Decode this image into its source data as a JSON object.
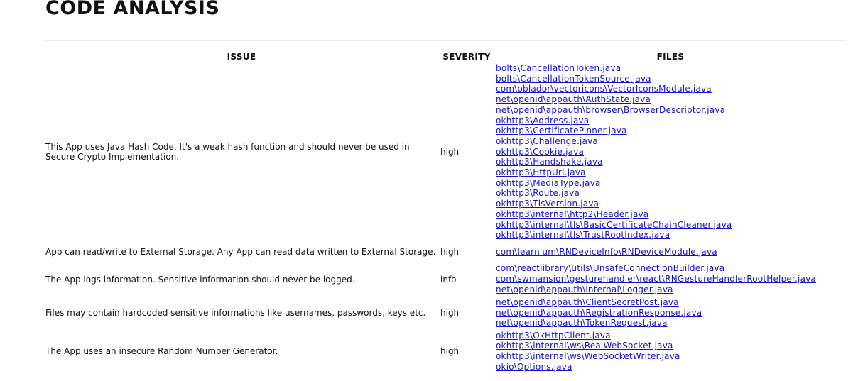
{
  "page": {
    "title": "CODE ANALYSIS"
  },
  "table": {
    "headers": {
      "issue": "ISSUE",
      "severity": "SEVERITY",
      "files": "FILES"
    },
    "rows": [
      {
        "issue": "This App uses Java Hash Code. It's a weak hash function and should never be used in Secure Crypto Implementation.",
        "severity": "high",
        "files": [
          "bolts\\CancellationToken.java",
          "bolts\\CancellationTokenSource.java",
          "com\\oblador\\vectoricons\\VectorIconsModule.java",
          "net\\openid\\appauth\\AuthState.java",
          "net\\openid\\appauth\\browser\\BrowserDescriptor.java",
          "okhttp3\\Address.java",
          "okhttp3\\CertificatePinner.java",
          "okhttp3\\Challenge.java",
          "okhttp3\\Cookie.java",
          "okhttp3\\Handshake.java",
          "okhttp3\\HttpUrl.java",
          "okhttp3\\MediaType.java",
          "okhttp3\\Route.java",
          "okhttp3\\TlsVersion.java",
          "okhttp3\\internal\\http2\\Header.java",
          "okhttp3\\internal\\tls\\BasicCertificateChainCleaner.java",
          "okhttp3\\internal\\tls\\TrustRootIndex.java"
        ]
      },
      {
        "issue": "App can read/write to External Storage. Any App can read data written to External Storage.",
        "severity": "high",
        "files": [
          "com\\learnium\\RNDeviceInfo\\RNDeviceModule.java"
        ]
      },
      {
        "issue": "The App logs information. Sensitive information should never be logged.",
        "severity": "info",
        "files": [
          "com\\reactlibrary\\utils\\UnsafeConnectionBuilder.java",
          "com\\swmansion\\gesturehandler\\react\\RNGestureHandlerRootHelper.java",
          "net\\openid\\appauth\\internal\\Logger.java"
        ]
      },
      {
        "issue": "Files may contain hardcoded sensitive informations like usernames, passwords, keys etc.",
        "severity": "high",
        "files": [
          "net\\openid\\appauth\\ClientSecretPost.java",
          "net\\openid\\appauth\\RegistrationResponse.java",
          "net\\openid\\appauth\\TokenRequest.java"
        ]
      },
      {
        "issue": "The App uses an insecure Random Number Generator.",
        "severity": "high",
        "files": [
          "okhttp3\\OkHttpClient.java",
          "okhttp3\\internal\\ws\\RealWebSocket.java",
          "okhttp3\\internal\\ws\\WebSocketWriter.java",
          "okio\\Options.java"
        ]
      }
    ]
  }
}
